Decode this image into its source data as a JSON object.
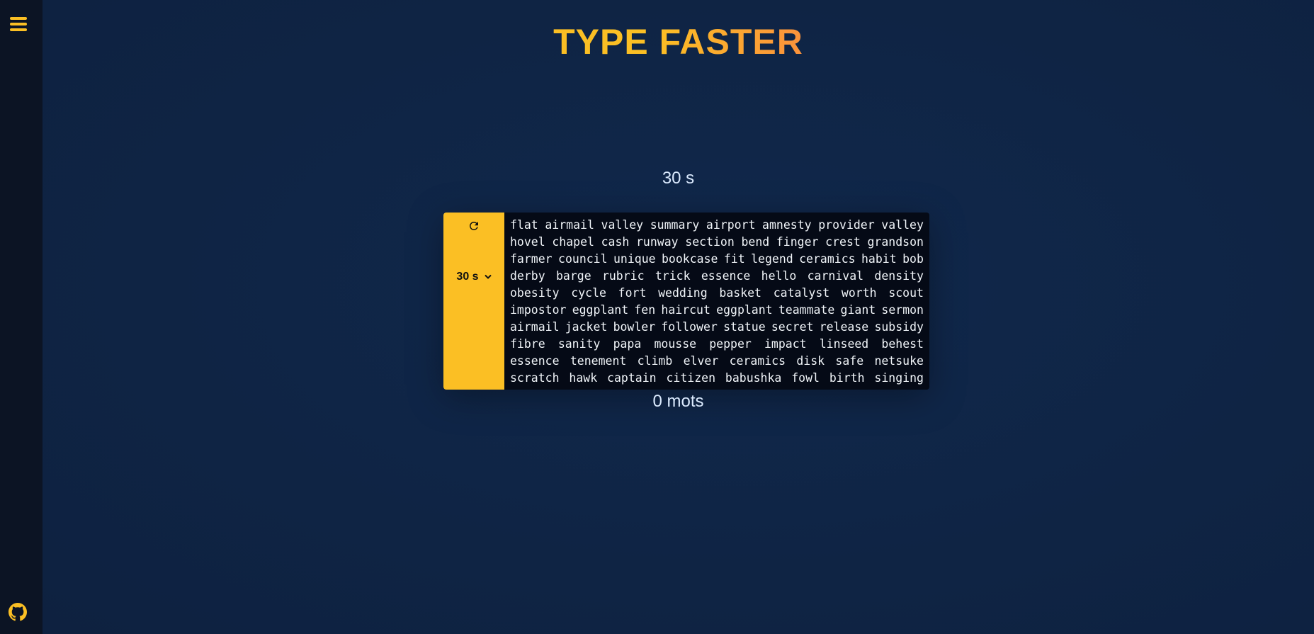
{
  "app": {
    "title": "TYPE FASTER",
    "accent_color": "#fbbf24",
    "accent_color_end": "#fb923c"
  },
  "sidebar": {
    "menu_icon": "hamburger-menu-icon",
    "github_icon": "github-icon"
  },
  "timer": {
    "display": "30 s"
  },
  "controls": {
    "restart_icon": "restart-icon",
    "duration": {
      "selected": "30 s",
      "icon": "chevron-down-icon"
    }
  },
  "words": {
    "lines": [
      [
        "flat",
        "airmail",
        "valley",
        "summary",
        "airport",
        "amnesty",
        "provider",
        "valley"
      ],
      [
        "hovel",
        "chapel",
        "cash",
        "runway",
        "section",
        "bend",
        "finger",
        "crest",
        "grandson"
      ],
      [
        "farmer",
        "council",
        "unique",
        "bookcase",
        "fit",
        "legend",
        "ceramics",
        "habit",
        "bob"
      ],
      [
        "derby",
        "barge",
        "rubric",
        "trick",
        "essence",
        "hello",
        "carnival",
        "density"
      ],
      [
        "obesity",
        "cycle",
        "fort",
        "wedding",
        "basket",
        "catalyst",
        "worth",
        "scout"
      ],
      [
        "impostor",
        "eggplant",
        "fen",
        "haircut",
        "eggplant",
        "teammate",
        "giant",
        "sermon"
      ],
      [
        "airmail",
        "jacket",
        "bowler",
        "follower",
        "statue",
        "secret",
        "release",
        "subsidy"
      ],
      [
        "fibre",
        "sanity",
        "papa",
        "mousse",
        "pepper",
        "impact",
        "linseed",
        "behest"
      ],
      [
        "essence",
        "tenement",
        "climb",
        "elver",
        "ceramics",
        "disk",
        "safe",
        "netsuke"
      ],
      [
        "scratch",
        "hawk",
        "captain",
        "citizen",
        "babushka",
        "fowl",
        "birth",
        "singing"
      ]
    ]
  },
  "stats": {
    "word_count": "0 mots"
  }
}
